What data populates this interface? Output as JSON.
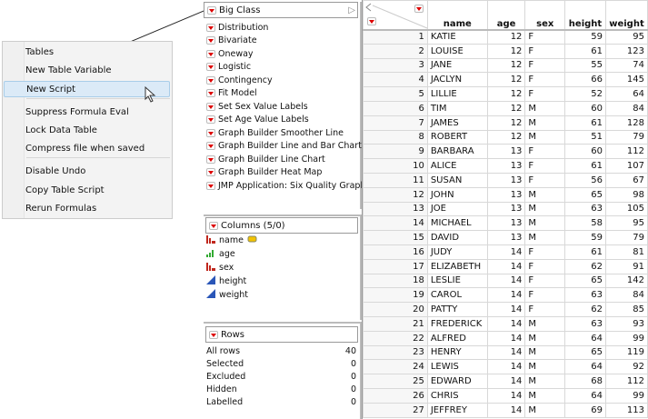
{
  "menu": {
    "items": [
      "Tables",
      "New Table Variable",
      "New Script",
      "Suppress Formula Eval",
      "Lock Data Table",
      "Compress file when saved",
      "Disable Undo",
      "Copy Table Script",
      "Rerun Formulas"
    ],
    "highlighted": "New Script"
  },
  "table_panel": {
    "title": "Big Class",
    "scripts": [
      "Distribution",
      "Bivariate",
      "Oneway",
      "Logistic",
      "Contingency",
      "Fit Model",
      "Set Sex Value Labels",
      "Set Age Value Labels",
      "Graph Builder Smoother Line",
      "Graph Builder Line and Bar Charts",
      "Graph Builder Line Chart",
      "Graph Builder Heat Map",
      "JMP Application: Six Quality Graph"
    ]
  },
  "columns_panel": {
    "title": "Columns (5/0)",
    "columns": [
      {
        "name": "name",
        "type": "nominal"
      },
      {
        "name": "age",
        "type": "ordinal"
      },
      {
        "name": "sex",
        "type": "nominal"
      },
      {
        "name": "height",
        "type": "continuous"
      },
      {
        "name": "weight",
        "type": "continuous"
      }
    ]
  },
  "rows_panel": {
    "title": "Rows",
    "items": [
      {
        "label": "All rows",
        "value": "40"
      },
      {
        "label": "Selected",
        "value": "0"
      },
      {
        "label": "Excluded",
        "value": "0"
      },
      {
        "label": "Hidden",
        "value": "0"
      },
      {
        "label": "Labelled",
        "value": "0"
      }
    ]
  },
  "grid": {
    "headers": [
      "name",
      "age",
      "sex",
      "height",
      "weight"
    ],
    "rows": [
      [
        "1",
        "KATIE",
        "12",
        "F",
        "59",
        "95"
      ],
      [
        "2",
        "LOUISE",
        "12",
        "F",
        "61",
        "123"
      ],
      [
        "3",
        "JANE",
        "12",
        "F",
        "55",
        "74"
      ],
      [
        "4",
        "JACLYN",
        "12",
        "F",
        "66",
        "145"
      ],
      [
        "5",
        "LILLIE",
        "12",
        "F",
        "52",
        "64"
      ],
      [
        "6",
        "TIM",
        "12",
        "M",
        "60",
        "84"
      ],
      [
        "7",
        "JAMES",
        "12",
        "M",
        "61",
        "128"
      ],
      [
        "8",
        "ROBERT",
        "12",
        "M",
        "51",
        "79"
      ],
      [
        "9",
        "BARBARA",
        "13",
        "F",
        "60",
        "112"
      ],
      [
        "10",
        "ALICE",
        "13",
        "F",
        "61",
        "107"
      ],
      [
        "11",
        "SUSAN",
        "13",
        "F",
        "56",
        "67"
      ],
      [
        "12",
        "JOHN",
        "13",
        "M",
        "65",
        "98"
      ],
      [
        "13",
        "JOE",
        "13",
        "M",
        "63",
        "105"
      ],
      [
        "14",
        "MICHAEL",
        "13",
        "M",
        "58",
        "95"
      ],
      [
        "15",
        "DAVID",
        "13",
        "M",
        "59",
        "79"
      ],
      [
        "16",
        "JUDY",
        "14",
        "F",
        "61",
        "81"
      ],
      [
        "17",
        "ELIZABETH",
        "14",
        "F",
        "62",
        "91"
      ],
      [
        "18",
        "LESLIE",
        "14",
        "F",
        "65",
        "142"
      ],
      [
        "19",
        "CAROL",
        "14",
        "F",
        "63",
        "84"
      ],
      [
        "20",
        "PATTY",
        "14",
        "F",
        "62",
        "85"
      ],
      [
        "21",
        "FREDERICK",
        "14",
        "M",
        "63",
        "93"
      ],
      [
        "22",
        "ALFRED",
        "14",
        "M",
        "64",
        "99"
      ],
      [
        "23",
        "HENRY",
        "14",
        "M",
        "65",
        "119"
      ],
      [
        "24",
        "LEWIS",
        "14",
        "M",
        "64",
        "92"
      ],
      [
        "25",
        "EDWARD",
        "14",
        "M",
        "68",
        "112"
      ],
      [
        "26",
        "CHRIS",
        "14",
        "M",
        "64",
        "99"
      ],
      [
        "27",
        "JEFFREY",
        "14",
        "M",
        "69",
        "113"
      ]
    ]
  }
}
